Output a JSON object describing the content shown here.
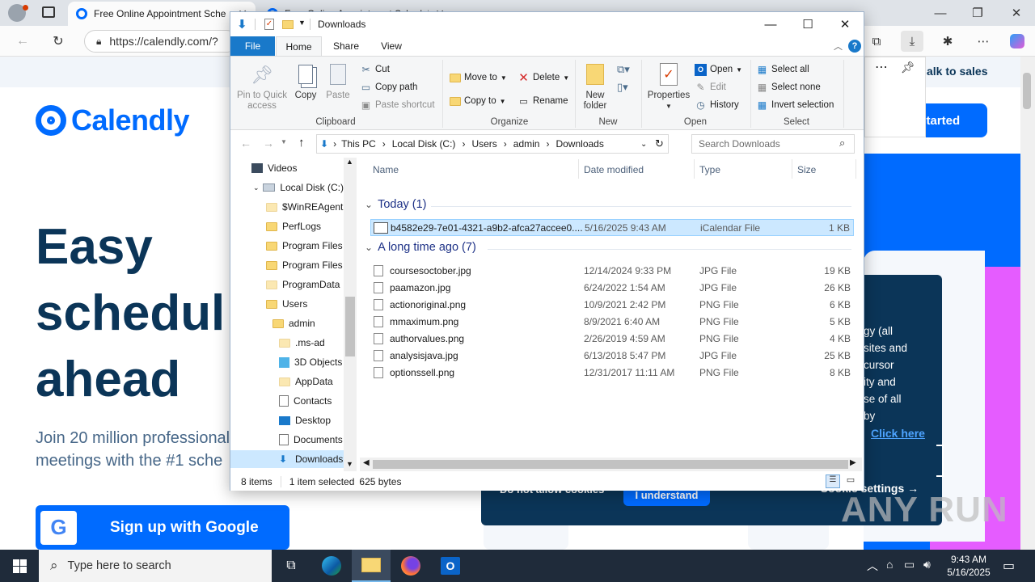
{
  "browser": {
    "tabs": [
      {
        "title": "Free Online Appointment Sche"
      },
      {
        "title": "Free Online Appointment Scheduling"
      }
    ],
    "url": "https://calendly.com/?"
  },
  "calendly": {
    "logo": "Calendly",
    "hero": [
      "Easy",
      "schedul",
      "ahead"
    ],
    "subtext": [
      "Join 20 million professional",
      "meetings with the #1 sche"
    ],
    "google_button": "Sign up with Google",
    "talk_to_sales": "alk to sales",
    "get_started": "t started",
    "cookie_lines": [
      "gy (all",
      "sites and",
      "cursor",
      "ity and",
      "se of all",
      "by"
    ],
    "click_here": "Click here",
    "not_allow": "Do not allow cookies",
    "understand": "I understand",
    "cookie_settings": "Cookie settings"
  },
  "watermark": "ANY RUN",
  "explorer": {
    "title": "Downloads",
    "ribbon_tabs": [
      "File",
      "Home",
      "Share",
      "View"
    ],
    "clipboard": {
      "pin": [
        "Pin to Quick",
        "access"
      ],
      "copy": "Copy",
      "paste": "Paste",
      "cut": "Cut",
      "copy_path": "Copy path",
      "paste_shortcut": "Paste shortcut",
      "label": "Clipboard"
    },
    "organize": {
      "move_to": "Move to",
      "copy_to": "Copy to",
      "delete": "Delete",
      "rename": "Rename",
      "label": "Organize"
    },
    "new": {
      "new_folder": [
        "New",
        "folder"
      ],
      "label": "New"
    },
    "open": {
      "properties": "Properties",
      "open": "Open",
      "edit": "Edit",
      "history": "History",
      "label": "Open"
    },
    "select": {
      "select_all": "Select all",
      "select_none": "Select none",
      "invert": "Invert selection",
      "label": "Select"
    },
    "path": [
      "This PC",
      "Local Disk (C:)",
      "Users",
      "admin",
      "Downloads"
    ],
    "search_placeholder": "Search Downloads",
    "nav_items": [
      {
        "label": "Videos",
        "indent": 0
      },
      {
        "label": "Local Disk (C:)",
        "indent": 0
      },
      {
        "label": "$WinREAgent",
        "indent": 1
      },
      {
        "label": "PerfLogs",
        "indent": 1
      },
      {
        "label": "Program Files",
        "indent": 1
      },
      {
        "label": "Program Files",
        "indent": 1
      },
      {
        "label": "ProgramData",
        "indent": 1
      },
      {
        "label": "Users",
        "indent": 1
      },
      {
        "label": "admin",
        "indent": 2
      },
      {
        "label": ".ms-ad",
        "indent": 3
      },
      {
        "label": "3D Objects",
        "indent": 3
      },
      {
        "label": "AppData",
        "indent": 3
      },
      {
        "label": "Contacts",
        "indent": 3
      },
      {
        "label": "Desktop",
        "indent": 3
      },
      {
        "label": "Documents",
        "indent": 3
      },
      {
        "label": "Downloads",
        "indent": 3
      }
    ],
    "columns": [
      "Name",
      "Date modified",
      "Type",
      "Size"
    ],
    "groups": [
      {
        "header": "Today (1)",
        "files": [
          {
            "name": "b4582e29-7e01-4321-a9b2-afca27accee0....",
            "date": "5/16/2025 9:43 AM",
            "type": "iCalendar File",
            "size": "1 KB",
            "selected": true
          }
        ]
      },
      {
        "header": "A long time ago (7)",
        "files": [
          {
            "name": "coursesoctober.jpg",
            "date": "12/14/2024 9:33 PM",
            "type": "JPG File",
            "size": "19 KB"
          },
          {
            "name": "paamazon.jpg",
            "date": "6/24/2022 1:54 AM",
            "type": "JPG File",
            "size": "26 KB"
          },
          {
            "name": "actionoriginal.png",
            "date": "10/9/2021 2:42 PM",
            "type": "PNG File",
            "size": "6 KB"
          },
          {
            "name": "mmaximum.png",
            "date": "8/9/2021 6:40 AM",
            "type": "PNG File",
            "size": "5 KB"
          },
          {
            "name": "authorvalues.png",
            "date": "2/26/2019 4:59 AM",
            "type": "PNG File",
            "size": "4 KB"
          },
          {
            "name": "analysisjava.jpg",
            "date": "6/13/2018 5:47 PM",
            "type": "JPG File",
            "size": "25 KB"
          },
          {
            "name": "optionssell.png",
            "date": "12/31/2017 11:11 AM",
            "type": "PNG File",
            "size": "8 KB"
          }
        ]
      }
    ],
    "status": {
      "items": "8 items",
      "selected": "1 item selected",
      "bytes": "625 bytes"
    }
  },
  "taskbar": {
    "search_placeholder": "Type here to search",
    "time": "9:43 AM",
    "date": "5/16/2025"
  }
}
